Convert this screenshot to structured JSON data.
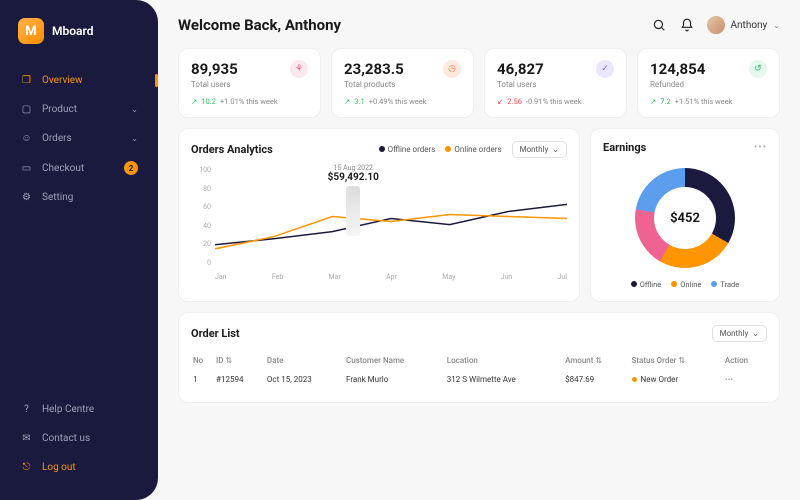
{
  "brand": {
    "initial": "M",
    "name": "Mboard"
  },
  "sidebar": {
    "items": [
      {
        "icon": "chart",
        "label": "Overview"
      },
      {
        "icon": "box",
        "label": "Product"
      },
      {
        "icon": "user",
        "label": "Orders"
      },
      {
        "icon": "card",
        "label": "Checkout",
        "badge": "2"
      },
      {
        "icon": "gear",
        "label": "Setting"
      }
    ],
    "bottom": [
      {
        "icon": "help",
        "label": "Help Centre"
      },
      {
        "icon": "chat",
        "label": "Contact us"
      },
      {
        "icon": "logout",
        "label": "Log out"
      }
    ]
  },
  "header": {
    "welcome": "Welcome Back, Anthony",
    "username": "Anthony"
  },
  "stats": [
    {
      "value": "89,935",
      "label": "Total users",
      "icon_color": "#fbe7ee",
      "icon_glyph": "👥",
      "trend_dir": "up",
      "trend_val": "10.2",
      "trend_text": "+1.01% this week"
    },
    {
      "value": "23,283.5",
      "label": "Total products",
      "icon_color": "#ffe9df",
      "icon_glyph": "📦",
      "trend_dir": "up",
      "trend_val": "3.1",
      "trend_text": "+0.49% this week"
    },
    {
      "value": "46,827",
      "label": "Total users",
      "icon_color": "#ece6ff",
      "icon_glyph": "✓",
      "trend_dir": "down",
      "trend_val": "2.56",
      "trend_text": "-0.91% this week"
    },
    {
      "value": "124,854",
      "label": "Refunded",
      "icon_color": "#e6f7ee",
      "icon_glyph": "↺",
      "trend_dir": "up",
      "trend_val": "7.2",
      "trend_text": "+1.51% this week"
    }
  ],
  "orders_chart": {
    "title": "Orders Analytics",
    "legend_offline": "Offline orders",
    "legend_online": "Online orders",
    "period": "Monthly",
    "tooltip_date": "15 Aug 2022",
    "tooltip_value": "$59,492.10"
  },
  "earnings": {
    "title": "Earnings",
    "center": "$452",
    "legend": [
      "Offline",
      "Online",
      "Trade"
    ]
  },
  "order_list": {
    "title": "Order List",
    "period": "Monthly",
    "columns": [
      "No",
      "ID",
      "Date",
      "Customer Name",
      "Location",
      "Amount",
      "Status Order",
      "Action"
    ],
    "rows": [
      {
        "no": "1",
        "id": "#12594",
        "date": "Oct 15, 2023",
        "customer": "Frank Murlo",
        "location": "312 S Wilmette Ave",
        "amount": "$847.69",
        "status": "New Order"
      }
    ]
  },
  "chart_data": [
    {
      "type": "line",
      "title": "Orders Analytics",
      "xlabel": "",
      "ylabel": "",
      "categories": [
        "Jan",
        "Feb",
        "Mar",
        "Apr",
        "May",
        "Jun",
        "Jul"
      ],
      "ylim": [
        0,
        100
      ],
      "y_ticks": [
        0,
        20,
        40,
        60,
        80,
        100
      ],
      "series": [
        {
          "name": "Offline orders",
          "color": "#1a1a3e",
          "values": [
            22,
            28,
            35,
            48,
            42,
            55,
            62
          ]
        },
        {
          "name": "Online orders",
          "color": "#ff9500",
          "values": [
            18,
            30,
            50,
            45,
            52,
            50,
            48
          ]
        }
      ],
      "annotation": {
        "x": "15 Aug 2022",
        "value": 59492.1
      }
    },
    {
      "type": "pie",
      "title": "Earnings",
      "center_value": 452,
      "series": [
        {
          "name": "Offline",
          "color": "#1a1a3e",
          "value": 33
        },
        {
          "name": "Online",
          "color": "#ff9500",
          "value": 25
        },
        {
          "name": "Trade (pink)",
          "color": "#f06292",
          "value": 20
        },
        {
          "name": "Trade (blue)",
          "color": "#5c9ded",
          "value": 22
        }
      ]
    }
  ]
}
